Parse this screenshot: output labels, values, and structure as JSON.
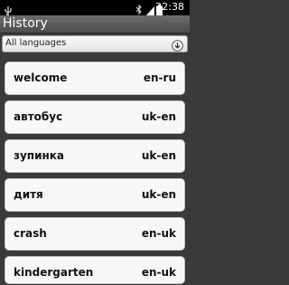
{
  "status_bar": {
    "time": "22:38",
    "icons": [
      "usb-icon",
      "bluetooth-icon",
      "signal-icon",
      "battery-icon"
    ]
  },
  "header": {
    "title": "History"
  },
  "language_filter": {
    "selected": "All languages",
    "icon": "download-icon"
  },
  "history": [
    {
      "word": "welcome",
      "pair": "en-ru"
    },
    {
      "word": "автобус",
      "pair": "uk-en"
    },
    {
      "word": "зупинка",
      "pair": "uk-en"
    },
    {
      "word": "дитя",
      "pair": "uk-en"
    },
    {
      "word": "crash",
      "pair": "en-uk"
    },
    {
      "word": "kindergarten",
      "pair": "en-uk"
    }
  ]
}
